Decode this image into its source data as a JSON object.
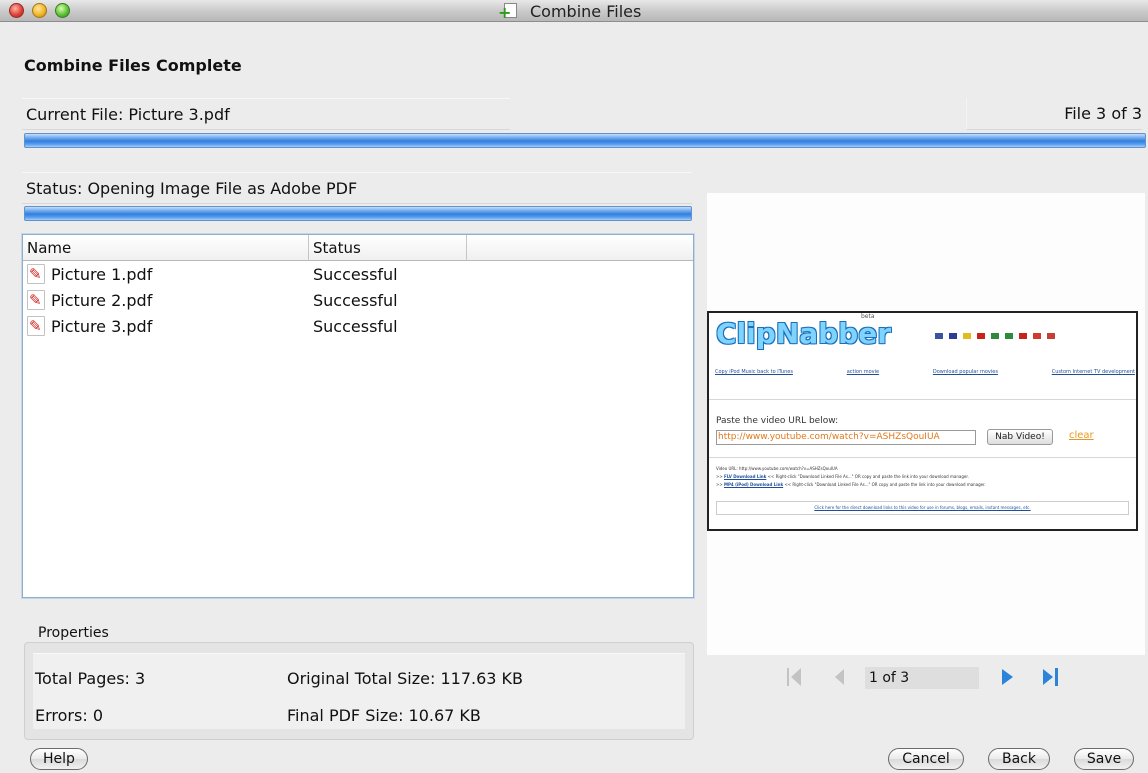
{
  "window": {
    "title": "Combine Files",
    "app_icon": "combine-files-icon"
  },
  "heading": "Combine Files Complete",
  "current_file": {
    "label": "Current File: Picture 3.pdf",
    "count": "File 3 of 3",
    "progress": 1.0
  },
  "status": {
    "label": "Status: Opening Image File as Adobe PDF",
    "progress": 1.0
  },
  "file_table": {
    "columns": [
      "Name",
      "Status"
    ],
    "rows": [
      {
        "name": "Picture 1.pdf",
        "status": "Successful",
        "icon": "pdf-file-icon"
      },
      {
        "name": "Picture 2.pdf",
        "status": "Successful",
        "icon": "pdf-file-icon"
      },
      {
        "name": "Picture 3.pdf",
        "status": "Successful",
        "icon": "pdf-file-icon"
      }
    ]
  },
  "preview": {
    "logo": "ClipNabber",
    "beta": "beta",
    "links": [
      "Copy iPod Music back to iTunes",
      "action movie",
      "Download popular movies",
      "Custom Internet TV development"
    ],
    "paste_label": "Paste the video URL below:",
    "url_value": "http://www.youtube.com/watch?v=ASHZsQouIUA",
    "nab_button": "Nab Video!",
    "clear_link": "clear",
    "video_url_line": "Video URL: http://www.youtube.com/watch?v=ASHZsQouIUA",
    "flv_prefix": ">>",
    "flv_link": "FLV Download Link",
    "flv_text": "<< Right-click \"Download Linked File As...\" OR copy and paste the link into your download manager.",
    "mp4_prefix": ">>",
    "mp4_link": "MP4 (iPod) Download Link",
    "mp4_text": "<< Right-click \"Download Linked File As...\" OR copy and paste the link into your download manager.",
    "bottom_link": "Click here for the direct download links to this video for use in forums, blogs, emails, instant messages, etc."
  },
  "pager": {
    "page_text": "1 of 3",
    "accent": "#2c83d9"
  },
  "properties": {
    "label": "Properties",
    "total_pages": "Total Pages: 3",
    "errors": "Errors: 0",
    "original_size": "Original Total Size: 117.63 KB",
    "final_size": "Final PDF Size: 10.67 KB"
  },
  "buttons": {
    "help": "Help",
    "cancel": "Cancel",
    "back": "Back",
    "save": "Save"
  },
  "colors": {
    "progress_blue": "#2f7fe0",
    "table_border": "#8eaecd"
  }
}
